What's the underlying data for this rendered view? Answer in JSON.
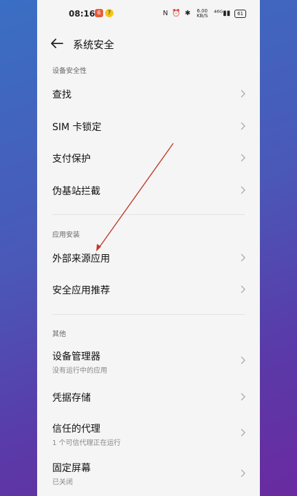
{
  "status": {
    "time": "08:16",
    "app1": "6",
    "app2": "?",
    "nfc": "N",
    "alarm": "⏰",
    "bt": "✱",
    "speed": "6.00 KB/S",
    "signal": "⁴⁶ᴳ▮▮",
    "battery": "61"
  },
  "header": {
    "title": "系统安全"
  },
  "sections": [
    {
      "label": "设备安全性"
    },
    {
      "label": "应用安装"
    },
    {
      "label": "其他"
    }
  ],
  "rows": [
    {
      "label": "查找"
    },
    {
      "label": "SIM 卡锁定"
    },
    {
      "label": "支付保护"
    },
    {
      "label": "伪基站拦截"
    },
    {
      "label": "外部来源应用"
    },
    {
      "label": "安全应用推荐"
    },
    {
      "label": "设备管理器",
      "sub": "没有运行中的应用"
    },
    {
      "label": "凭据存储"
    },
    {
      "label": "信任的代理",
      "sub": "1 个可信代理正在运行"
    },
    {
      "label": "固定屏幕",
      "sub": "已关闭"
    }
  ],
  "colors": {
    "annotation_arrow": "#c0392b"
  }
}
